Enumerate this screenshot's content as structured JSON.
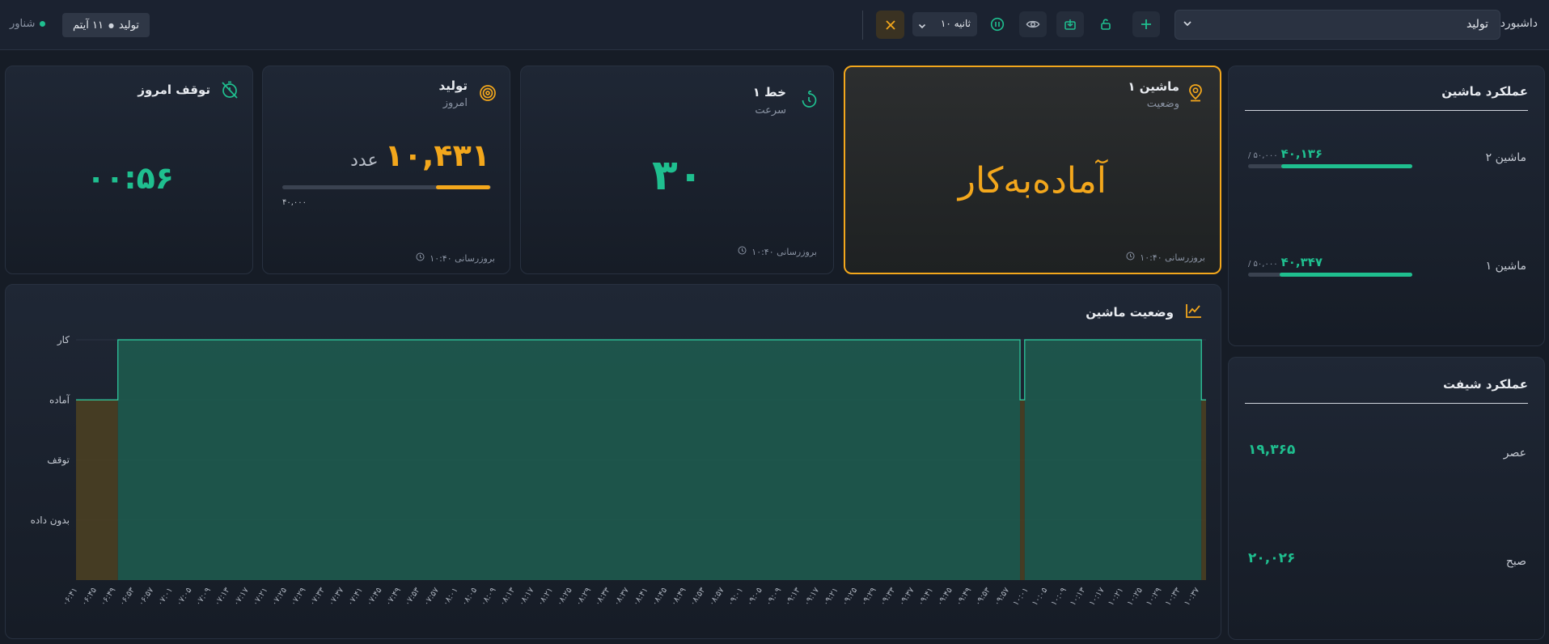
{
  "topbar": {
    "dashboard_label": "داشبورد",
    "dashboard_select_value": "تولید",
    "refresh_interval": "۱۰ ثانیه",
    "tag_label": "تولید",
    "tag_count": "۱۱ آیتم",
    "floating_label": "شناور",
    "colors": {
      "accent": "#1fbf8f",
      "close_bg": "#3a3222",
      "close_x": "#f3a71c"
    }
  },
  "cards": {
    "machine_status": {
      "title": "ماشین ۱",
      "subtitle": "وضعیت",
      "value": "آماده‌به‌کار",
      "updated": "بروزرسانی ۱۰:۴۰",
      "icon": "map-pin-icon",
      "color": "#f3a71c"
    },
    "line_speed": {
      "title": "خط ۱",
      "subtitle": "سرعت",
      "value": "۳۰",
      "updated": "بروزرسانی ۱۰:۴۰",
      "icon": "timer-icon",
      "color": "#1fbf8f"
    },
    "production": {
      "title": "تولید",
      "subtitle": "امروز",
      "value": "۱۰,۴۳۱",
      "unit": "عدد",
      "goal": "۴۰,۰۰۰",
      "progress": 0.26,
      "updated": "بروزرسانی ۱۰:۴۰",
      "icon": "target-icon",
      "color": "#f3a71c"
    },
    "downtime": {
      "title": "توقف امروز",
      "value": "۰۰:۵۶",
      "icon": "timer-off-icon",
      "color": "#1fbf8f"
    }
  },
  "machine_performance": {
    "title": "عملکرد ماشین",
    "items": [
      {
        "name": "ماشین ۲",
        "value": "۴۰,۱۳۶",
        "target": "/ ۵۰,۰۰۰",
        "progress": 0.8
      },
      {
        "name": "ماشین ۱",
        "value": "۴۰,۳۴۷",
        "target": "/ ۵۰,۰۰۰",
        "progress": 0.81
      }
    ]
  },
  "shift_performance": {
    "title": "عملکرد شیفت",
    "items": [
      {
        "name": "عصر",
        "value": "۱۹,۳۶۵"
      },
      {
        "name": "صبح",
        "value": "۲۰,۰۲۶"
      }
    ]
  },
  "chart_data": {
    "type": "area",
    "title": "وضعیت ماشین",
    "y_categories": [
      "کار",
      "آماده",
      "توقف",
      "بدون داده"
    ],
    "x_ticks": [
      "۰۶:۴۱",
      "۰۶:۴۵",
      "۰۶:۴۹",
      "۰۶:۵۳",
      "۰۶:۵۷",
      "۰۷:۰۱",
      "۰۷:۰۵",
      "۰۷:۰۹",
      "۰۷:۱۳",
      "۰۷:۱۷",
      "۰۷:۲۱",
      "۰۷:۲۵",
      "۰۷:۲۹",
      "۰۷:۳۳",
      "۰۷:۳۷",
      "۰۷:۴۱",
      "۰۷:۴۵",
      "۰۷:۴۹",
      "۰۷:۵۳",
      "۰۷:۵۷",
      "۰۸:۰۱",
      "۰۸:۰۵",
      "۰۸:۰۹",
      "۰۸:۱۳",
      "۰۸:۱۷",
      "۰۸:۲۱",
      "۰۸:۲۵",
      "۰۸:۲۹",
      "۰۸:۳۳",
      "۰۸:۳۷",
      "۰۸:۴۱",
      "۰۸:۴۵",
      "۰۸:۴۹",
      "۰۸:۵۳",
      "۰۸:۵۷",
      "۰۹:۰۱",
      "۰۹:۰۵",
      "۰۹:۰۹",
      "۰۹:۱۳",
      "۰۹:۱۷",
      "۰۹:۲۱",
      "۰۹:۲۵",
      "۰۹:۲۹",
      "۰۹:۳۳",
      "۰۹:۳۷",
      "۰۹:۴۱",
      "۰۹:۴۵",
      "۰۹:۴۹",
      "۰۹:۵۳",
      "۰۹:۵۷",
      "۱۰:۰۱",
      "۱۰:۰۵",
      "۱۰:۰۹",
      "۱۰:۱۳",
      "۱۰:۱۷",
      "۱۰:۲۱",
      "۱۰:۲۵",
      "۱۰:۲۹",
      "۱۰:۳۳",
      "۱۰:۳۷"
    ],
    "segments": [
      {
        "state": "آماده",
        "from": "06:38",
        "to": "06:47",
        "color": "#4a3f22"
      },
      {
        "state": "کار",
        "from": "06:47",
        "to": "10:01",
        "color": "#1e5a4e"
      },
      {
        "state": "آماده",
        "from": "10:01",
        "to": "10:02",
        "color": "#4a3f22"
      },
      {
        "state": "کار",
        "from": "10:02",
        "to": "10:40",
        "color": "#1e5a4e"
      },
      {
        "state": "آماده",
        "from": "10:40",
        "to": "10:41",
        "color": "#4a3f22"
      }
    ],
    "grid": true
  }
}
